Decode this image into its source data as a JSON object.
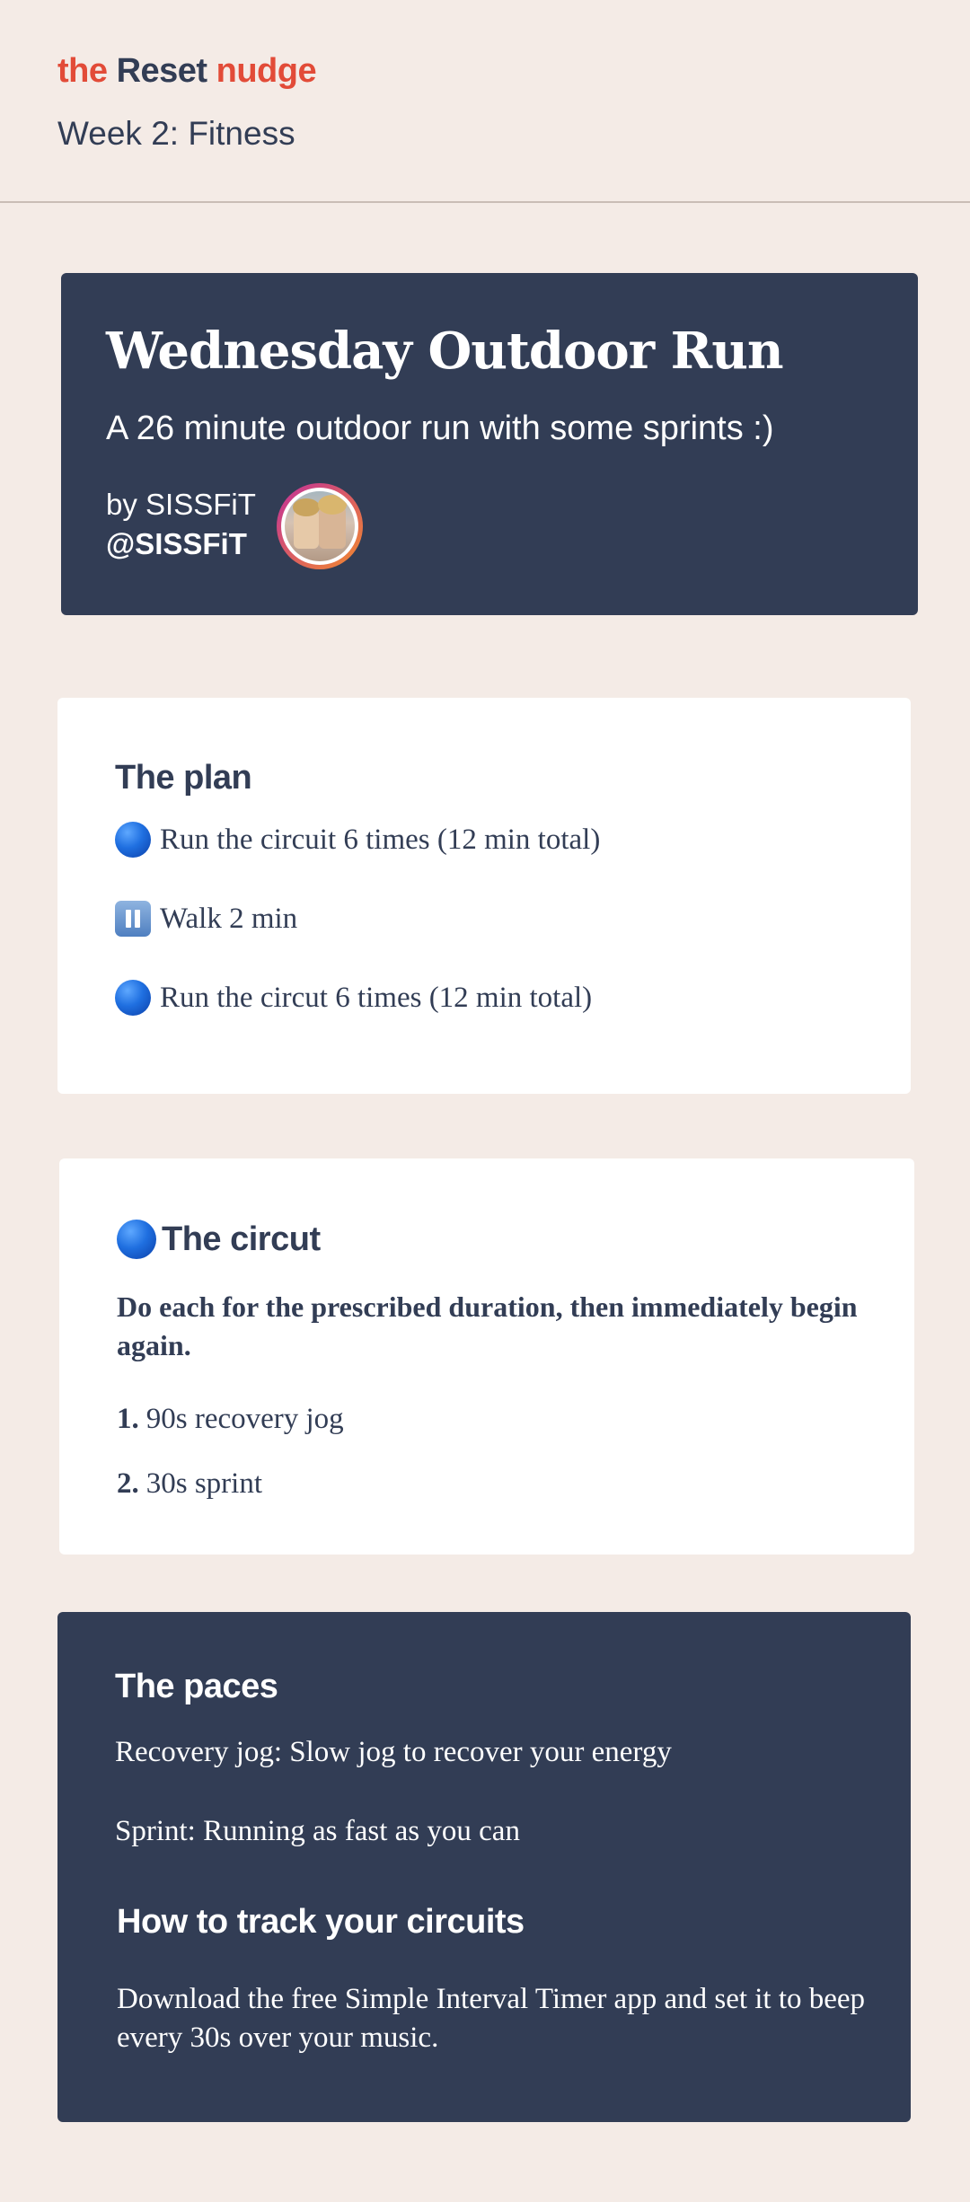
{
  "header": {
    "brand": {
      "the": "the",
      "reset": "Reset",
      "nudge": "nudge"
    },
    "week": "Week 2: Fitness"
  },
  "hero": {
    "title": "Wednesday Outdoor Run",
    "subtitle": "A 26 minute outdoor run with some sprints :)",
    "by_line": "by SISSFiT",
    "handle": "@SISSFiT"
  },
  "plan": {
    "title": "The plan",
    "items": [
      {
        "icon": "blue-circle-icon",
        "text": "Run the circuit 6 times (12 min total)"
      },
      {
        "icon": "pause-button-icon",
        "text": "Walk 2 min"
      },
      {
        "icon": "blue-circle-icon",
        "text": "Run the circut 6 times (12 min total)"
      }
    ]
  },
  "circuit": {
    "title": "The circut",
    "description": "Do each for the prescribed duration, then immediately begin again.",
    "steps": [
      {
        "num": "1.",
        "text": "90s recovery jog"
      },
      {
        "num": "2.",
        "text": "30s sprint"
      }
    ]
  },
  "paces": {
    "title": "The paces",
    "lines": [
      "Recovery jog: Slow jog to recover your energy",
      "Sprint: Running as fast as you can"
    ],
    "track_title": "How to track your circuits",
    "track_desc": "Download the free Simple Interval Timer app and set it to beep every 30s over your music."
  },
  "colors": {
    "background": "#f4ebe6",
    "navy": "#323d55",
    "brand_red": "#e24b38",
    "card": "#ffffff"
  }
}
